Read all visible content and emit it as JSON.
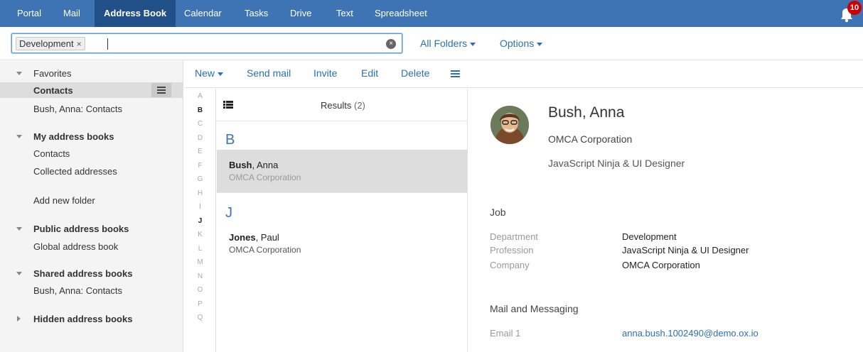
{
  "nav": {
    "items": [
      "Portal",
      "Mail",
      "Address Book",
      "Calendar",
      "Tasks",
      "Drive",
      "Text",
      "Spreadsheet"
    ],
    "active": "Address Book",
    "notification_count": "10"
  },
  "search": {
    "token": "Development",
    "token_remove": "×",
    "value": "",
    "all_folders": "All Folders",
    "options": "Options"
  },
  "sidebar": {
    "favorites": "Favorites",
    "favorites_items": [
      "Contacts",
      "Bush, Anna: Contacts"
    ],
    "my_books": "My address books",
    "my_books_items": [
      "Contacts",
      "Collected addresses"
    ],
    "add_folder": "Add new folder",
    "public_books": "Public address books",
    "public_items": [
      "Global address book"
    ],
    "shared_books": "Shared address books",
    "shared_items": [
      "Bush, Anna: Contacts"
    ],
    "hidden_books": "Hidden address books"
  },
  "toolbar": {
    "new": "New",
    "send_mail": "Send mail",
    "invite": "Invite",
    "edit": "Edit",
    "delete": "Delete"
  },
  "alphabet": {
    "letters": [
      "A",
      "B",
      "C",
      "D",
      "E",
      "F",
      "G",
      "H",
      "I",
      "J",
      "K",
      "L",
      "M",
      "N",
      "O",
      "P",
      "Q"
    ],
    "with_entries": [
      "B",
      "J"
    ]
  },
  "list": {
    "results_label": "Results",
    "results_count": "(2)",
    "groups": [
      {
        "letter": "B",
        "contacts": [
          {
            "last": "Bush",
            "first": ", Anna",
            "company": "OMCA Corporation",
            "selected": true
          }
        ]
      },
      {
        "letter": "J",
        "contacts": [
          {
            "last": "Jones",
            "first": ", Paul",
            "company": "OMCA Corporation",
            "selected": false
          }
        ]
      }
    ]
  },
  "detail": {
    "name": "Bush, Anna",
    "company": "OMCA Corporation",
    "title": "JavaScript Ninja & UI Designer",
    "job_heading": "Job",
    "job_fields": [
      {
        "label": "Department",
        "value": "Development"
      },
      {
        "label": "Profession",
        "value": "JavaScript Ninja & UI Designer"
      },
      {
        "label": "Company",
        "value": "OMCA Corporation"
      }
    ],
    "mail_heading": "Mail and Messaging",
    "mail_fields": [
      {
        "label": "Email 1",
        "value": "anna.bush.1002490@demo.ox.io"
      }
    ]
  },
  "colors": {
    "nav_bg": "#3f74b4",
    "nav_active": "#214f88",
    "link": "#2a6fb7",
    "badge": "#cc0000"
  }
}
